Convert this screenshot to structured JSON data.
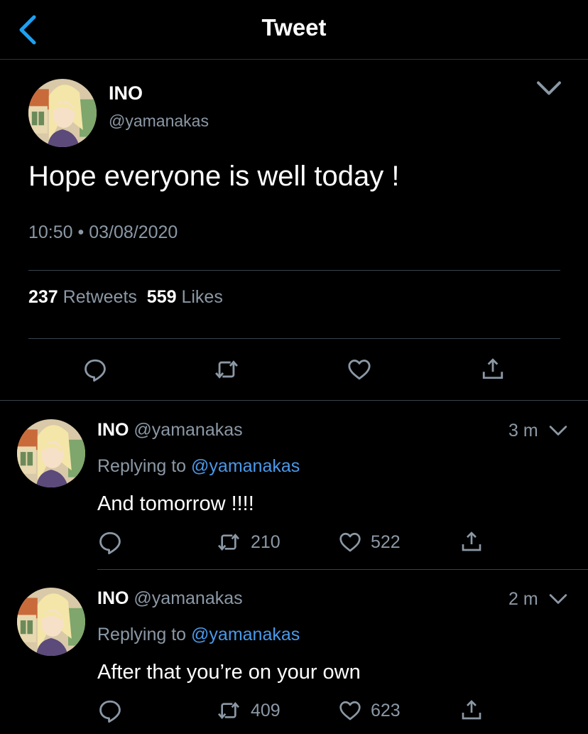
{
  "header": {
    "title": "Tweet"
  },
  "main_tweet": {
    "name": "INO",
    "handle": "@yamanakas",
    "text": "Hope everyone is well today !",
    "timestamp": "10:50 • 03/08/2020",
    "retweet_count": "237",
    "retweet_label": "Retweets",
    "like_count": "559",
    "like_label": "Likes"
  },
  "replies": [
    {
      "name": "INO",
      "handle": "@yamanakas",
      "time": "3 m",
      "replying_prefix": "Replying to",
      "replying_to": "@yamanakas",
      "text": "And tomorrow !!!!",
      "retweets": "210",
      "likes": "522"
    },
    {
      "name": "INO",
      "handle": "@yamanakas",
      "time": "2 m",
      "replying_prefix": "Replying to",
      "replying_to": "@yamanakas",
      "text": "After that you’re on your own",
      "retweets": "409",
      "likes": "623"
    }
  ],
  "icons": {
    "back": "chevron-left-icon",
    "more": "chevron-down-icon",
    "reply": "reply-icon",
    "retweet": "retweet-icon",
    "like": "heart-icon",
    "share": "share-icon"
  },
  "colors": {
    "accent": "#1da1f2",
    "link": "#4a99e9",
    "muted": "#8b98a5",
    "separator": "#38444d"
  }
}
